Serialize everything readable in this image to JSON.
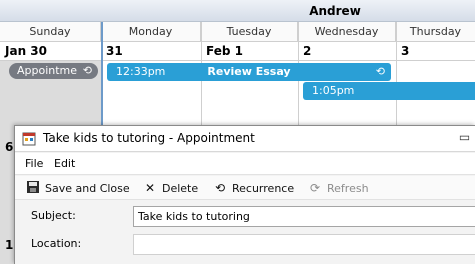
{
  "calendar": {
    "owner": "Andrew",
    "day_headers": [
      "Sunday",
      "Monday",
      "Tuesday",
      "Wednesday",
      "Thursday"
    ],
    "date_labels": [
      "Jan 30",
      "31",
      "Feb 1",
      "2",
      "3"
    ],
    "row_labels": [
      "6",
      "1"
    ],
    "appointments": [
      {
        "label": "Appointme",
        "icon": "recurrence-icon"
      },
      {
        "time": "12:33pm",
        "title": "Review Essay",
        "icon": "recurrence-icon"
      },
      {
        "time": "1:05pm"
      }
    ],
    "colors": {
      "appointment_blue": "#2a9fd6",
      "appointment_grey": "#767a82"
    }
  },
  "dialog": {
    "title": "Take kids to tutoring - Appointment",
    "menu": [
      "File",
      "Edit"
    ],
    "toolbar": {
      "save_close": "Save and Close",
      "delete": "Delete",
      "recurrence": "Recurrence",
      "refresh": "Refresh"
    },
    "subject_label": "Subject:",
    "subject_value": "Take kids to tutoring",
    "location_label": "Location:",
    "location_value": ""
  }
}
